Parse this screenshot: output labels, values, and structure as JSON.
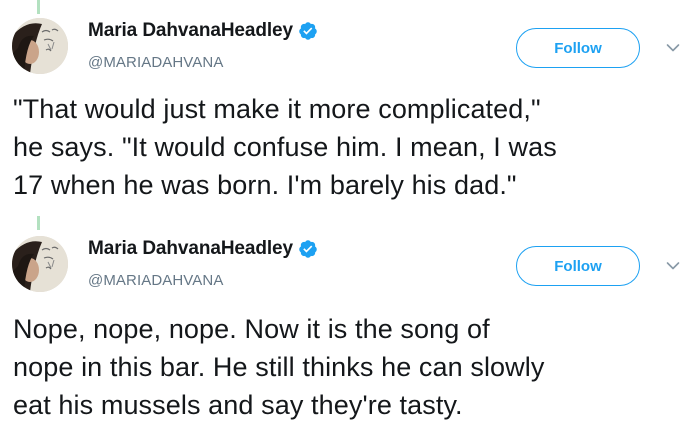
{
  "tweets": [
    {
      "display_name": "Maria DahvanaHeadley",
      "handle": "@MARIADAHVANA",
      "follow_label": "Follow",
      "verified": true,
      "text_lines": [
        "\"That would just make it more complicated,\"",
        "he says. \"It would confuse him. I mean, I was",
        "17 when he was born. I'm barely his dad.\""
      ]
    },
    {
      "display_name": "Maria DahvanaHeadley",
      "handle": "@MARIADAHVANA",
      "follow_label": "Follow",
      "verified": true,
      "text_lines": [
        "Nope, nope, nope. Now it is the song of",
        "nope in this bar. He still thinks he can slowly",
        "eat his mussels and say they're tasty."
      ]
    }
  ],
  "colors": {
    "accent": "#1da1f2",
    "text": "#14171a",
    "muted": "#657786",
    "thread_line": "#b3e1c0"
  },
  "icons": {
    "verified": "verified-badge-icon",
    "menu": "chevron-down-icon"
  }
}
